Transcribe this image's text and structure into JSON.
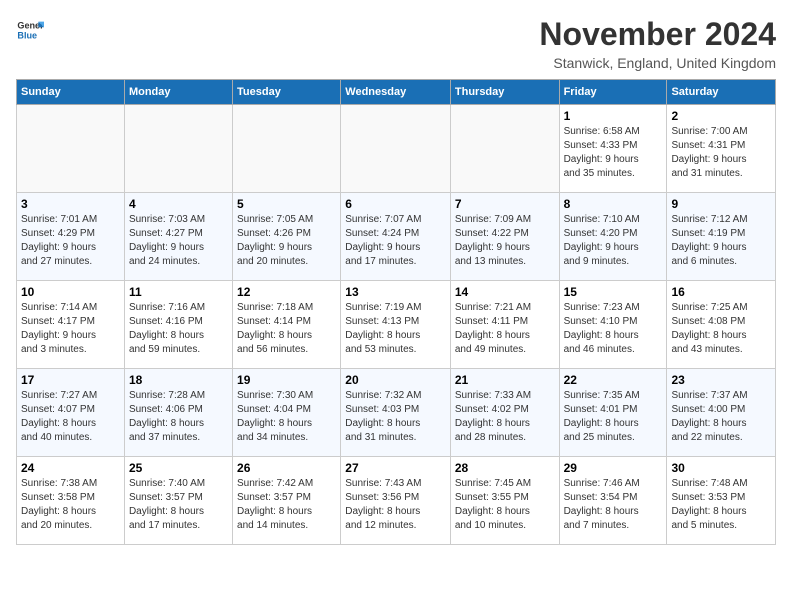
{
  "logo": {
    "general": "General",
    "blue": "Blue"
  },
  "title": "November 2024",
  "location": "Stanwick, England, United Kingdom",
  "headers": [
    "Sunday",
    "Monday",
    "Tuesday",
    "Wednesday",
    "Thursday",
    "Friday",
    "Saturday"
  ],
  "weeks": [
    [
      {
        "day": "",
        "info": ""
      },
      {
        "day": "",
        "info": ""
      },
      {
        "day": "",
        "info": ""
      },
      {
        "day": "",
        "info": ""
      },
      {
        "day": "",
        "info": ""
      },
      {
        "day": "1",
        "info": "Sunrise: 6:58 AM\nSunset: 4:33 PM\nDaylight: 9 hours\nand 35 minutes."
      },
      {
        "day": "2",
        "info": "Sunrise: 7:00 AM\nSunset: 4:31 PM\nDaylight: 9 hours\nand 31 minutes."
      }
    ],
    [
      {
        "day": "3",
        "info": "Sunrise: 7:01 AM\nSunset: 4:29 PM\nDaylight: 9 hours\nand 27 minutes."
      },
      {
        "day": "4",
        "info": "Sunrise: 7:03 AM\nSunset: 4:27 PM\nDaylight: 9 hours\nand 24 minutes."
      },
      {
        "day": "5",
        "info": "Sunrise: 7:05 AM\nSunset: 4:26 PM\nDaylight: 9 hours\nand 20 minutes."
      },
      {
        "day": "6",
        "info": "Sunrise: 7:07 AM\nSunset: 4:24 PM\nDaylight: 9 hours\nand 17 minutes."
      },
      {
        "day": "7",
        "info": "Sunrise: 7:09 AM\nSunset: 4:22 PM\nDaylight: 9 hours\nand 13 minutes."
      },
      {
        "day": "8",
        "info": "Sunrise: 7:10 AM\nSunset: 4:20 PM\nDaylight: 9 hours\nand 9 minutes."
      },
      {
        "day": "9",
        "info": "Sunrise: 7:12 AM\nSunset: 4:19 PM\nDaylight: 9 hours\nand 6 minutes."
      }
    ],
    [
      {
        "day": "10",
        "info": "Sunrise: 7:14 AM\nSunset: 4:17 PM\nDaylight: 9 hours\nand 3 minutes."
      },
      {
        "day": "11",
        "info": "Sunrise: 7:16 AM\nSunset: 4:16 PM\nDaylight: 8 hours\nand 59 minutes."
      },
      {
        "day": "12",
        "info": "Sunrise: 7:18 AM\nSunset: 4:14 PM\nDaylight: 8 hours\nand 56 minutes."
      },
      {
        "day": "13",
        "info": "Sunrise: 7:19 AM\nSunset: 4:13 PM\nDaylight: 8 hours\nand 53 minutes."
      },
      {
        "day": "14",
        "info": "Sunrise: 7:21 AM\nSunset: 4:11 PM\nDaylight: 8 hours\nand 49 minutes."
      },
      {
        "day": "15",
        "info": "Sunrise: 7:23 AM\nSunset: 4:10 PM\nDaylight: 8 hours\nand 46 minutes."
      },
      {
        "day": "16",
        "info": "Sunrise: 7:25 AM\nSunset: 4:08 PM\nDaylight: 8 hours\nand 43 minutes."
      }
    ],
    [
      {
        "day": "17",
        "info": "Sunrise: 7:27 AM\nSunset: 4:07 PM\nDaylight: 8 hours\nand 40 minutes."
      },
      {
        "day": "18",
        "info": "Sunrise: 7:28 AM\nSunset: 4:06 PM\nDaylight: 8 hours\nand 37 minutes."
      },
      {
        "day": "19",
        "info": "Sunrise: 7:30 AM\nSunset: 4:04 PM\nDaylight: 8 hours\nand 34 minutes."
      },
      {
        "day": "20",
        "info": "Sunrise: 7:32 AM\nSunset: 4:03 PM\nDaylight: 8 hours\nand 31 minutes."
      },
      {
        "day": "21",
        "info": "Sunrise: 7:33 AM\nSunset: 4:02 PM\nDaylight: 8 hours\nand 28 minutes."
      },
      {
        "day": "22",
        "info": "Sunrise: 7:35 AM\nSunset: 4:01 PM\nDaylight: 8 hours\nand 25 minutes."
      },
      {
        "day": "23",
        "info": "Sunrise: 7:37 AM\nSunset: 4:00 PM\nDaylight: 8 hours\nand 22 minutes."
      }
    ],
    [
      {
        "day": "24",
        "info": "Sunrise: 7:38 AM\nSunset: 3:58 PM\nDaylight: 8 hours\nand 20 minutes."
      },
      {
        "day": "25",
        "info": "Sunrise: 7:40 AM\nSunset: 3:57 PM\nDaylight: 8 hours\nand 17 minutes."
      },
      {
        "day": "26",
        "info": "Sunrise: 7:42 AM\nSunset: 3:57 PM\nDaylight: 8 hours\nand 14 minutes."
      },
      {
        "day": "27",
        "info": "Sunrise: 7:43 AM\nSunset: 3:56 PM\nDaylight: 8 hours\nand 12 minutes."
      },
      {
        "day": "28",
        "info": "Sunrise: 7:45 AM\nSunset: 3:55 PM\nDaylight: 8 hours\nand 10 minutes."
      },
      {
        "day": "29",
        "info": "Sunrise: 7:46 AM\nSunset: 3:54 PM\nDaylight: 8 hours\nand 7 minutes."
      },
      {
        "day": "30",
        "info": "Sunrise: 7:48 AM\nSunset: 3:53 PM\nDaylight: 8 hours\nand 5 minutes."
      }
    ]
  ]
}
